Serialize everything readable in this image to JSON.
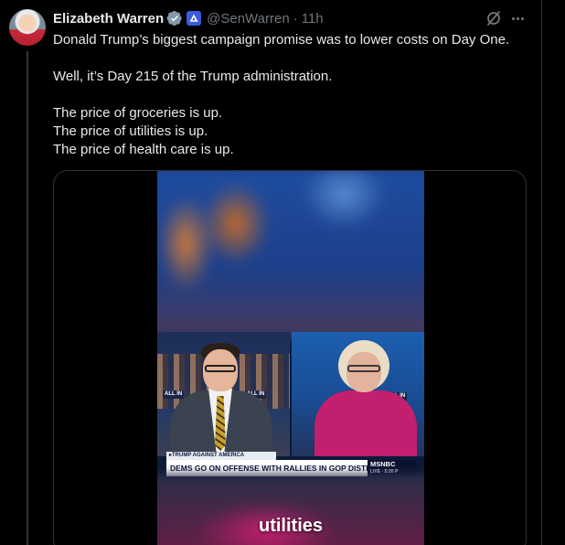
{
  "author": {
    "name": "Elizabeth Warren",
    "handle": "@SenWarren",
    "separator": "·",
    "time": "11h"
  },
  "icons": {
    "verified": "verified-badge-icon",
    "government": "government-affiliation-icon",
    "grok": "grok-icon",
    "more": "more-options-icon"
  },
  "tweet": {
    "line1": "Donald Trump’s biggest campaign promise was to lower costs on Day One.",
    "line2": "Well, it’s Day 215 of the Trump administration.",
    "line3": "The price of groceries is up.",
    "line4": "The price of utilities is up.",
    "line5": "The price of health care is up."
  },
  "video": {
    "chyron_top": "▸TRUMP AGAINST AMERICA",
    "chyron_main": "DEMS GO ON OFFENSE WITH RALLIES IN GOP DISTRICTS",
    "network": "MSNBC",
    "network_sub": "LIVE · 5:20 P",
    "host_logo": "ALL IN",
    "host_logo2": "ALL IN",
    "guest_logo": "ALL IN",
    "caption": "utilities"
  },
  "colors": {
    "background": "#000000",
    "text": "#e7e9ea",
    "secondary_text": "#71767b",
    "verified": "#1d9bf0",
    "msnbc_chyron_accent": "#c21f6e"
  }
}
